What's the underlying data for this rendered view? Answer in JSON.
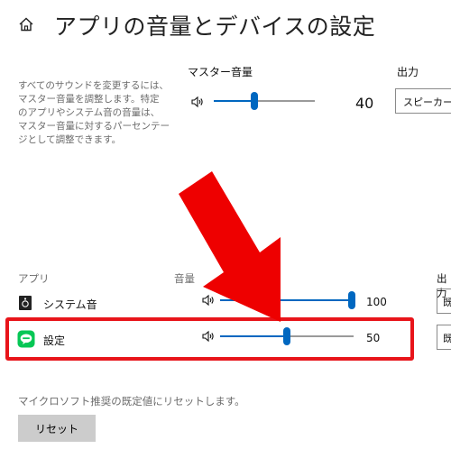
{
  "header": {
    "title": "アプリの音量とデバイスの設定",
    "home_icon": "home-icon"
  },
  "description": [
    "すべてのサウンドを変更するには、",
    "マスター音量を調整します。特定",
    "のアプリやシステム音の音量は、",
    "マスター音量に対するパーセンテー",
    "ジとして調整できます。"
  ],
  "master": {
    "label": "マスター音量",
    "value": "40",
    "level": 40
  },
  "output": {
    "label": "出力",
    "selected": "スピーカー"
  },
  "apps": {
    "column_app": "アプリ",
    "column_volume": "音量",
    "column_output": "出力",
    "items": [
      {
        "name": "システム音",
        "value": "100",
        "level": 100,
        "output": "既"
      },
      {
        "name": "設定",
        "value": "50",
        "level": 50,
        "output": "既"
      }
    ]
  },
  "reset": {
    "description": "マイクロソフト推奨の既定値にリセットします。",
    "button_label": "リセット"
  },
  "colors": {
    "accent": "#0067c0",
    "highlight": "#e8141a",
    "arrow": "#ee0000"
  }
}
